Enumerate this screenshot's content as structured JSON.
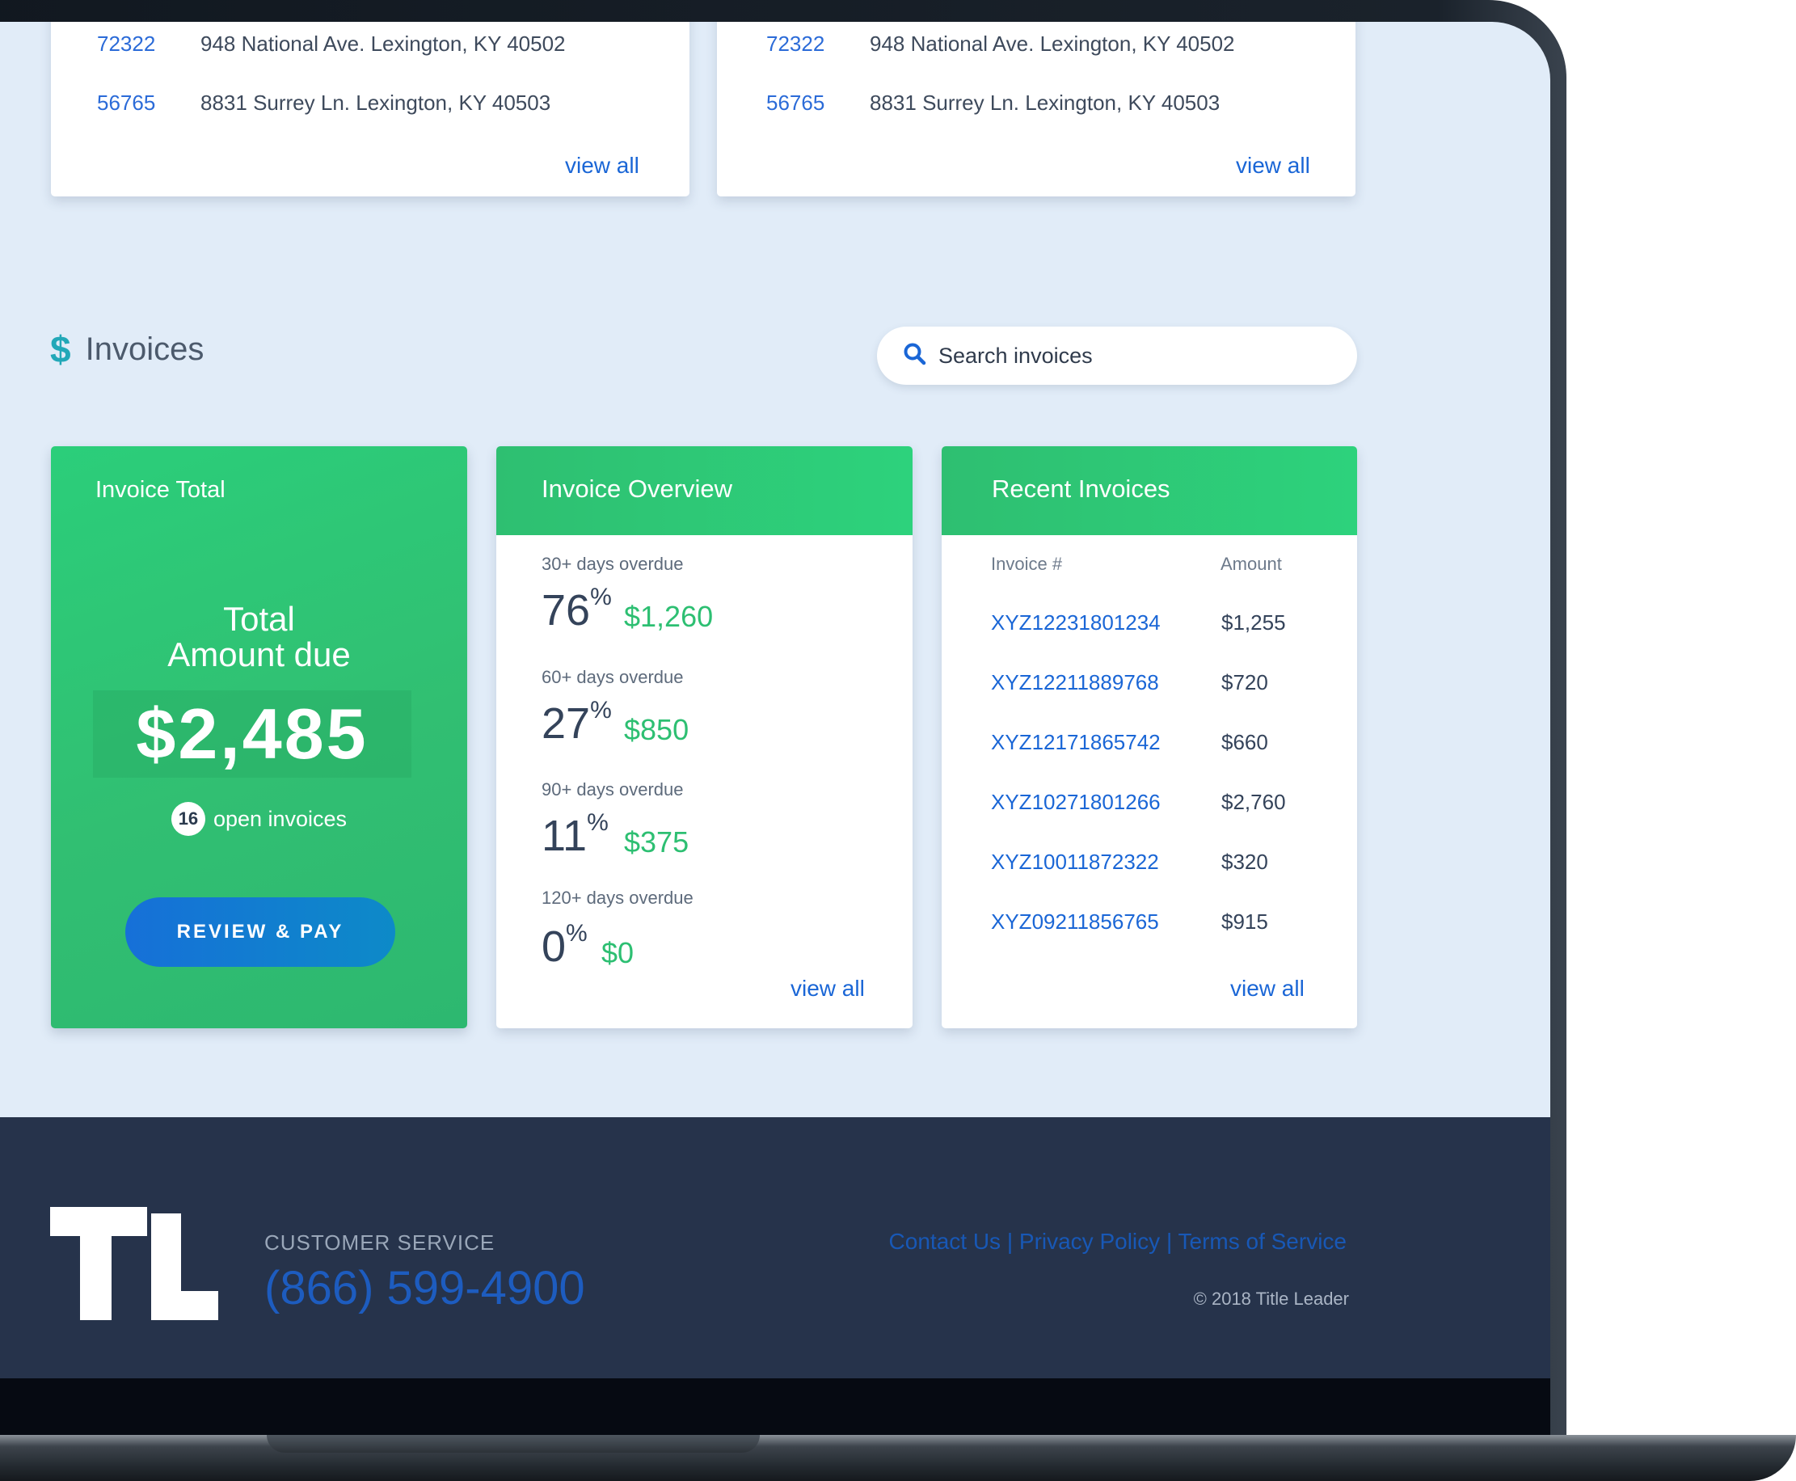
{
  "address_cards": [
    {
      "rows": [
        {
          "num": "72322",
          "address": "948 National Ave. Lexington, KY 40502"
        },
        {
          "num": "56765",
          "address": "8831 Surrey Ln. Lexington, KY 40503"
        }
      ],
      "view_all": "view all"
    },
    {
      "rows": [
        {
          "num": "72322",
          "address": "948 National Ave. Lexington, KY 40502"
        },
        {
          "num": "56765",
          "address": "8831 Surrey Ln. Lexington, KY 40503"
        }
      ],
      "view_all": "view all"
    }
  ],
  "invoices_section": {
    "icon": "$",
    "title": "Invoices",
    "search_placeholder": "Search invoices"
  },
  "invoice_total": {
    "heading": "Invoice Total",
    "label_line1": "Total",
    "label_line2": "Amount due",
    "amount": "$2,485",
    "open_count": "16",
    "open_label": "open invoices",
    "button": "REVIEW & PAY"
  },
  "invoice_overview": {
    "heading": "Invoice Overview",
    "rows": [
      {
        "label": "30+ days overdue",
        "pct": "76",
        "amount": "$1,260"
      },
      {
        "label": "60+ days overdue",
        "pct": "27",
        "amount": "$850"
      },
      {
        "label": "90+ days overdue",
        "pct": "11",
        "amount": "$375"
      },
      {
        "label": "120+ days overdue",
        "pct": "0",
        "amount": "$0"
      }
    ],
    "pct_symbol": "%",
    "view_all": "view all"
  },
  "recent_invoices": {
    "heading": "Recent Invoices",
    "col_invoice": "Invoice #",
    "col_amount": "Amount",
    "rows": [
      {
        "number": "XYZ12231801234",
        "amount": "$1,255"
      },
      {
        "number": "XYZ12211889768",
        "amount": "$720"
      },
      {
        "number": "XYZ12171865742",
        "amount": "$660"
      },
      {
        "number": "XYZ10271801266",
        "amount": "$2,760"
      },
      {
        "number": "XYZ10011872322",
        "amount": "$320"
      },
      {
        "number": "XYZ09211856765",
        "amount": "$915"
      }
    ],
    "view_all": "view all"
  },
  "footer": {
    "customer_service_label": "CUSTOMER SERVICE",
    "phone": "(866) 599-4900",
    "links": [
      "Contact Us",
      "Privacy Policy",
      "Terms of Service"
    ],
    "separator": "|",
    "copyright": "© 2018 Title Leader"
  },
  "colors": {
    "accent_green": "#2dbf72",
    "link_blue": "#1a66d6",
    "footer_bg": "#26334b"
  }
}
